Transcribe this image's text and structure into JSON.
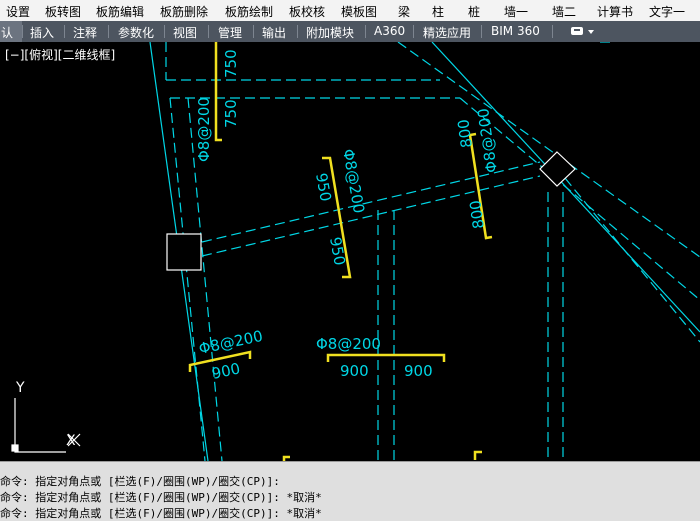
{
  "menu": {
    "items": [
      "设置",
      "板转图",
      "板筋编辑",
      "板筋删除",
      "板筋绘制",
      "板校核",
      "模板图",
      "梁",
      "柱",
      "桩",
      "墙一",
      "墙二",
      "计算书",
      "文字一"
    ]
  },
  "ribbon": {
    "active_tab_partial": "认",
    "tabs": [
      "插入",
      "注释",
      "参数化",
      "视图",
      "管理",
      "输出",
      "附加模块",
      "A360",
      "精选应用",
      "BIM 360"
    ]
  },
  "viewport": {
    "label": "[−][俯视][二维线框]",
    "background": "#000000",
    "line_color_cyan": "#00d7e6",
    "rebar_color_yellow": "#f0e020",
    "annotations": {
      "top_vertical_1": "750",
      "top_vertical_2": "750",
      "left_rebar_spec": "Φ8@200",
      "center_rebar_spec": "Φ8@200",
      "center_len_top": "950",
      "center_len_bottom": "950",
      "right_rebar_spec": "Φ8@200",
      "right_len_top": "800",
      "right_len_bottom": "800",
      "bottom_left_spec": "Φ8@200",
      "bottom_left_len": "900",
      "bottom_mid_spec": "Φ8@200",
      "bottom_mid_len_left": "900",
      "bottom_mid_len_right": "900"
    },
    "ucs": {
      "y_label": "Y",
      "x_label": "X"
    }
  },
  "command": {
    "lines": [
      "命令: 指定对角点或 [栏选(F)/圈围(WP)/圈交(CP)]:",
      "命令: 指定对角点或 [栏选(F)/圈围(WP)/圈交(CP)]: *取消*",
      "命令: 指定对角点或 [栏选(F)/圈围(WP)/圈交(CP)]: *取消*"
    ]
  }
}
